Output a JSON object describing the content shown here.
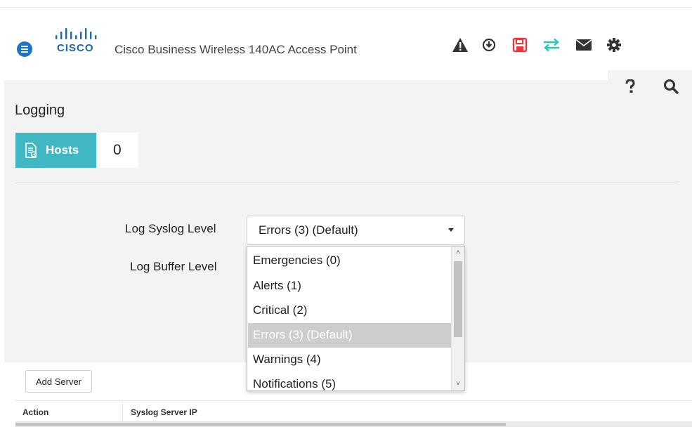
{
  "header": {
    "app_title": "Cisco Business Wireless 140AC Access Point",
    "logo_text": "CISCO",
    "icons": [
      "menu-icon",
      "warning-icon",
      "download-icon",
      "save-icon",
      "transfer-icon",
      "mail-icon",
      "gear-icon",
      "help-icon",
      "search-icon"
    ],
    "colors": {
      "menu": "#1c74c6",
      "save": "#e8383d",
      "transfer": "#2ec4b6",
      "logo": "#1c6aa8"
    }
  },
  "page": {
    "title": "Logging",
    "hosts_label": "Hosts",
    "hosts_count": "0",
    "accent": "#41b7c4"
  },
  "form": {
    "syslog_label": "Log Syslog Level",
    "buffer_label": "Log Buffer Level",
    "syslog_value": "Errors (3) (Default)"
  },
  "dropdown": {
    "options": [
      "Emergencies (0)",
      "Alerts (1)",
      "Critical (2)",
      "Errors (3) (Default)",
      "Warnings (4)",
      "Notifications (5)"
    ],
    "selected_index": 3
  },
  "table": {
    "add_button": "Add Server",
    "columns": [
      "Action",
      "Syslog Server IP"
    ]
  }
}
